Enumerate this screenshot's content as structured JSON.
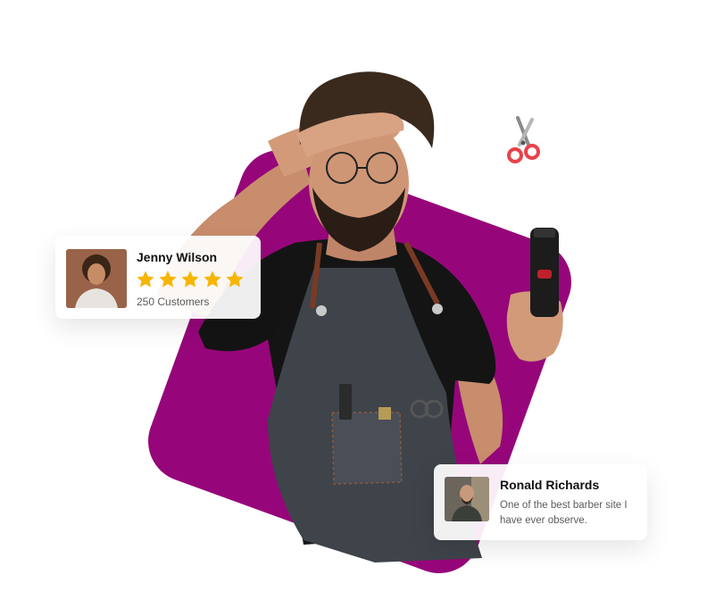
{
  "colors": {
    "accent": "#96067a",
    "star": "#f7b500",
    "scissor_handle": "#e8424a"
  },
  "hero": {
    "photo": "barber-shading-eyes-holding-trimmer"
  },
  "reviews": [
    {
      "name": "Jenny Wilson",
      "rating": 5,
      "customers": "250 Customers",
      "avatar": "smiling-curly-haired-man-photo"
    },
    {
      "name": "Ronald Richards",
      "text": "One of the best barber site I have ever observe.",
      "avatar": "bearded-man-in-barbershop-photo"
    }
  ],
  "icons": {
    "decoration": "scissors-icon",
    "rating": "star-icon"
  }
}
